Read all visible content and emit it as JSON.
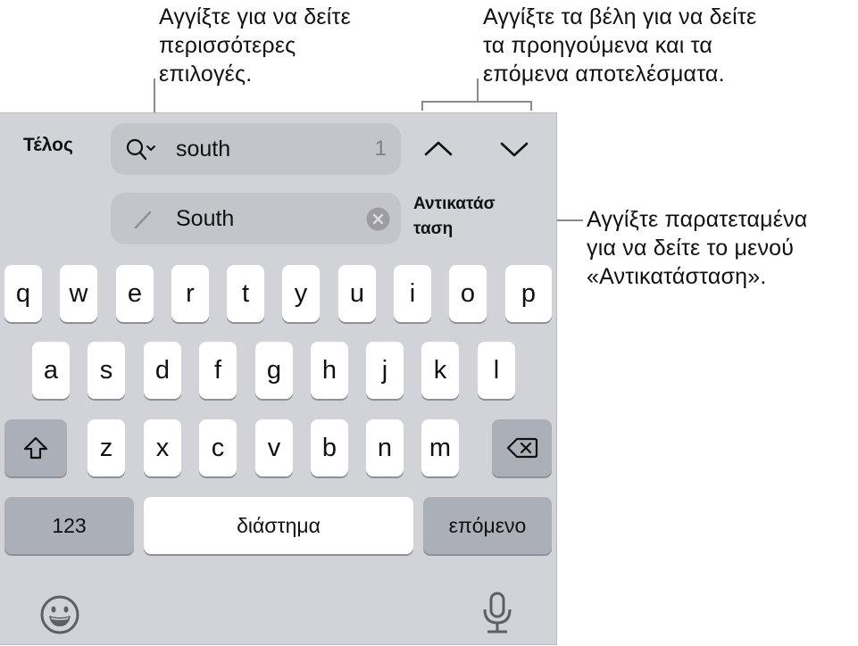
{
  "callouts": {
    "search_options": [
      "Αγγίξτε για να δείτε",
      "περισσότερες",
      "επιλογές."
    ],
    "arrows": [
      "Αγγίξτε τα βέλη για να δείτε",
      "τα προηγούμενα και τα",
      "επόμενα αποτελέσματα."
    ],
    "replace": [
      "Αγγίξτε παρατεταμένα",
      "για να δείτε το μενού",
      "«Αντικατάσταση»."
    ]
  },
  "find_bar": {
    "done_label": "Τέλος",
    "search_value": "south",
    "match_count": "1",
    "replace_value": "South",
    "replace_button_lines": [
      "Αντικατάσ",
      "ταση"
    ],
    "icons": {
      "search": "magnifier-with-chevron-icon",
      "previous": "chevron-up-icon",
      "next": "chevron-down-icon",
      "replace": "pencil-icon",
      "clear": "clear-x-icon"
    }
  },
  "keyboard": {
    "row1": [
      "q",
      "w",
      "e",
      "r",
      "t",
      "y",
      "u",
      "i",
      "o",
      "p"
    ],
    "row2": [
      "a",
      "s",
      "d",
      "f",
      "g",
      "h",
      "j",
      "k",
      "l"
    ],
    "row3": [
      "z",
      "x",
      "c",
      "v",
      "b",
      "n",
      "m"
    ],
    "numbers_label": "123",
    "space_label": "διάστημα",
    "return_label": "επόμενο",
    "icons": {
      "shift": "shift-arrow-icon",
      "delete": "delete-backspace-icon",
      "emoji": "emoji-smiley-icon",
      "dictation": "microphone-icon"
    }
  },
  "colors": {
    "panel": "#d1d3d9",
    "key": "#ffffff",
    "dark_key": "#abafb8",
    "field": "#c3c5cb",
    "callout_line": "#8a8a8e"
  }
}
